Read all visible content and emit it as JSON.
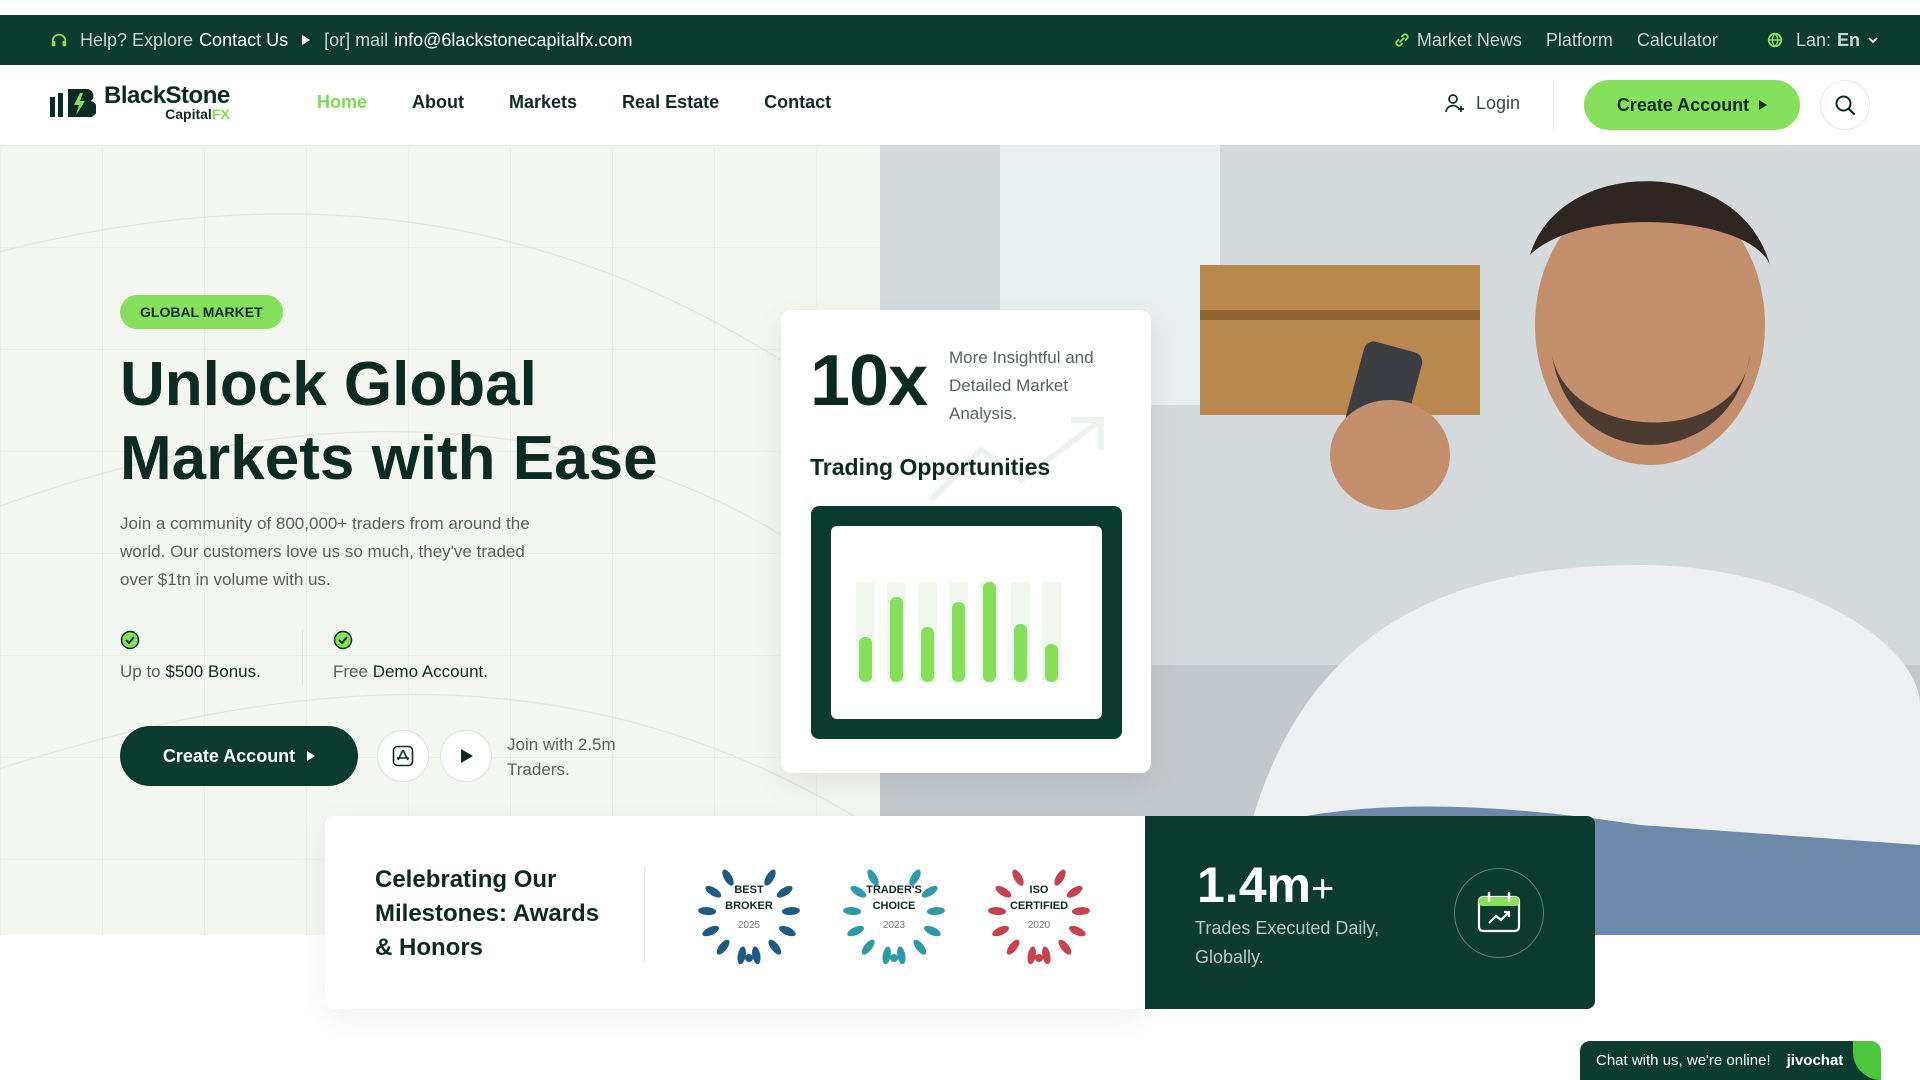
{
  "topbar": {
    "help_prefix": "Help? Explore",
    "help_link": "Contact Us",
    "mail_prefix": "[or] mail",
    "mail_address": "info@6lackstonecapitalfx.com",
    "links": [
      "Market News",
      "Platform",
      "Calculator"
    ],
    "lang_label": "Lan:",
    "lang_value": "En"
  },
  "brand": {
    "name": "BlackStone",
    "sub_a": "Capital",
    "sub_b": "FX"
  },
  "nav": {
    "items": [
      "Home",
      "About",
      "Markets",
      "Real Estate",
      "Contact"
    ],
    "active": "Home"
  },
  "header": {
    "login": "Login",
    "cta": "Create Account"
  },
  "hero": {
    "badge": "GLOBAL MARKET",
    "title_l1": "Unlock Global",
    "title_l2": "Markets with Ease",
    "lead": "Join a community of 800,000+ traders from around the world. Our customers love us so much, they've traded over $1tn in volume with us.",
    "feature1_pre": "Up to",
    "feature1_b": "$500 Bonus.",
    "feature2_pre": "Free",
    "feature2_b": "Demo Account.",
    "cta": "Create Account",
    "join": "Join with 2.5m Traders."
  },
  "card": {
    "big": "10x",
    "desc": "More Insightful and Detailed Market Analysis.",
    "subtitle": "Trading Opportunities",
    "bars": [
      0.45,
      0.85,
      0.55,
      0.8,
      1.0,
      0.58,
      0.38
    ]
  },
  "awards": {
    "title": "Celebrating Our Milestones: Awards & Honors",
    "items": [
      {
        "l1": "BEST",
        "l2": "BROKER",
        "year": "2025",
        "color": "#1f5a82"
      },
      {
        "l1": "TRADER'S",
        "l2": "CHOICE",
        "year": "2023",
        "color": "#2e9aa7"
      },
      {
        "l1": "ISO",
        "l2": "CERTIFIED",
        "year": "2020",
        "color": "#c4434f"
      }
    ]
  },
  "stats": {
    "value": "1.4m",
    "suffix": "+",
    "label": "Trades Executed Daily, Globally."
  },
  "chat": {
    "text": "Chat with us, we're online!",
    "brand": "jivochat"
  },
  "colors": {
    "dark_green": "#0b3a2e",
    "accent_green": "#86e05c"
  }
}
